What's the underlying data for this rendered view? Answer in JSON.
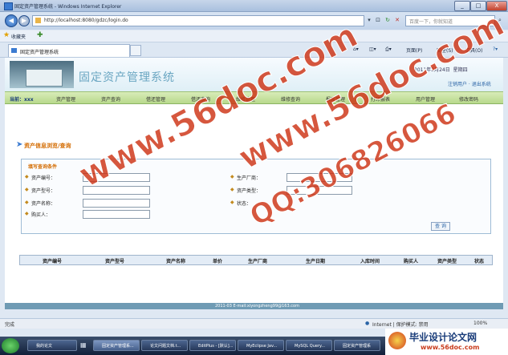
{
  "window": {
    "title": "固定资产管理系统 - Windows Internet Explorer",
    "controls": [
      "_",
      "□",
      "X"
    ]
  },
  "address": {
    "url": "http://localhost:8080/gdzc/login.do",
    "search_placeholder": "百度一下，你就知道"
  },
  "favorites": {
    "label": "收藏夹"
  },
  "tab": {
    "label": "固定资产管理系统"
  },
  "commands": [
    "页面(P)",
    "安全(S)",
    "工具(O)"
  ],
  "header": {
    "system_name": "固定资产管理系统",
    "date": "2011年2月24日",
    "weekday": "星期四",
    "user_links": "注销用户 · 退出系统"
  },
  "menu": {
    "home": "当前：xxx",
    "items": [
      "资产管理",
      "资产查询",
      "借还管理",
      "借还查询",
      "维修管理",
      "维修查询",
      "报废管理",
      "打印报表",
      "用户管理",
      "修改密码"
    ]
  },
  "section_title": "资产信息浏览/查询",
  "query": {
    "title": "填写查询条件",
    "left_fields": [
      "资产编号：",
      "资产型号：",
      "资产名称：",
      "购买人："
    ],
    "right_fields": [
      "生产厂商：",
      "资产类型：",
      "状态："
    ],
    "button": "查 询"
  },
  "table": {
    "headers": [
      "资产编号",
      "资产型号",
      "资产名称",
      "单价",
      "生产厂商",
      "生产日期",
      "入库时间",
      "购买人",
      "资产类型",
      "状态"
    ]
  },
  "footer": {
    "text": "2011-03 E-mail:xiyongzheng99@163.com"
  },
  "status": {
    "left": "完成",
    "zone": "Internet | 保护模式: 禁用",
    "zoom": "100%"
  },
  "taskbar": {
    "items": [
      "我的论文",
      "固定资产管理系...",
      "论文问题文档.t...",
      "EditPlus - [默认]...",
      "MyEclipse Jav...",
      "MySQL Query...",
      "固定资产管理系"
    ]
  },
  "watermark": {
    "site": "www.56doc.com",
    "qq": "QQ:306826066"
  },
  "brand": {
    "name": "毕业设计论文网",
    "site": "www.56doc.com"
  }
}
